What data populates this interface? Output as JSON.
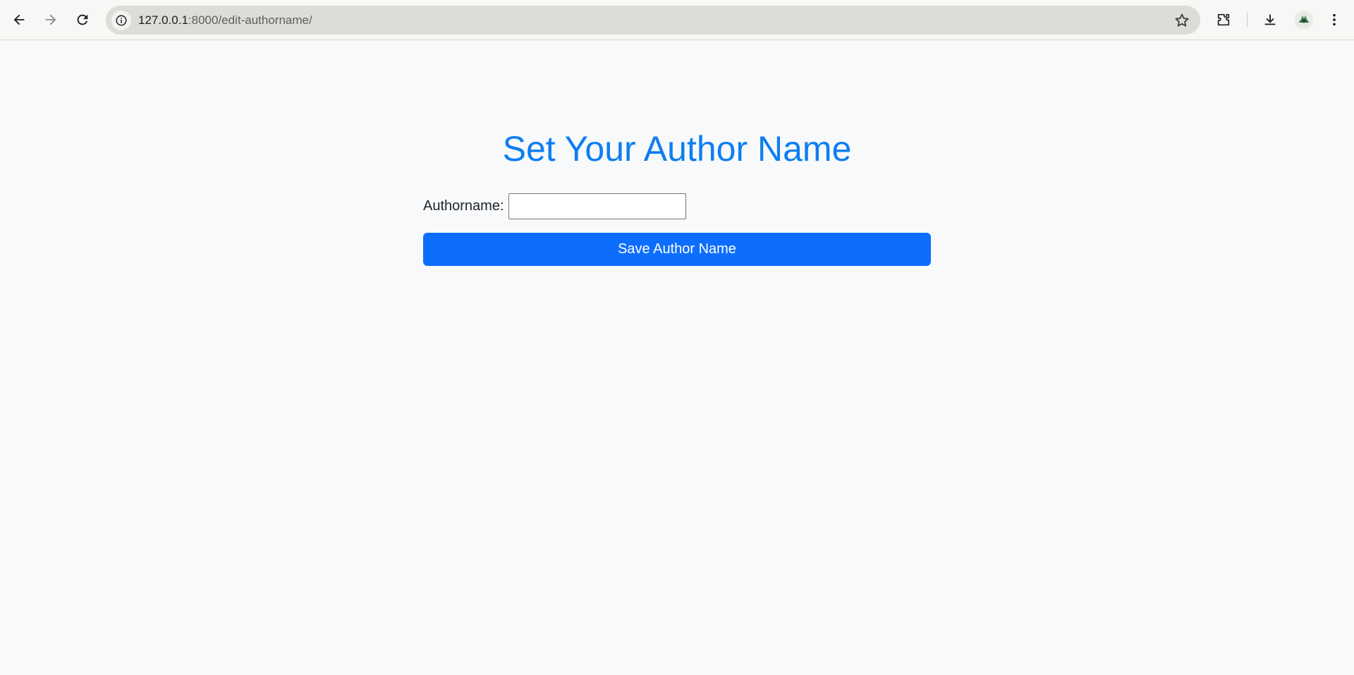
{
  "browser": {
    "url_host": "127.0.0.1",
    "url_path": ":8000/edit-authorname/"
  },
  "page": {
    "title": "Set Your Author Name",
    "field_label": "Authorname:",
    "field_value": "",
    "save_label": "Save Author Name"
  },
  "colors": {
    "title": "#0d7ef2",
    "button": "#0d6efd",
    "background": "#f8f9fa"
  },
  "icons": [
    "back-icon",
    "forward-icon",
    "reload-icon",
    "site-info-icon",
    "bookmark-star-icon",
    "extensions-icon",
    "download-icon",
    "profile-avatar",
    "more-menu-icon"
  ]
}
